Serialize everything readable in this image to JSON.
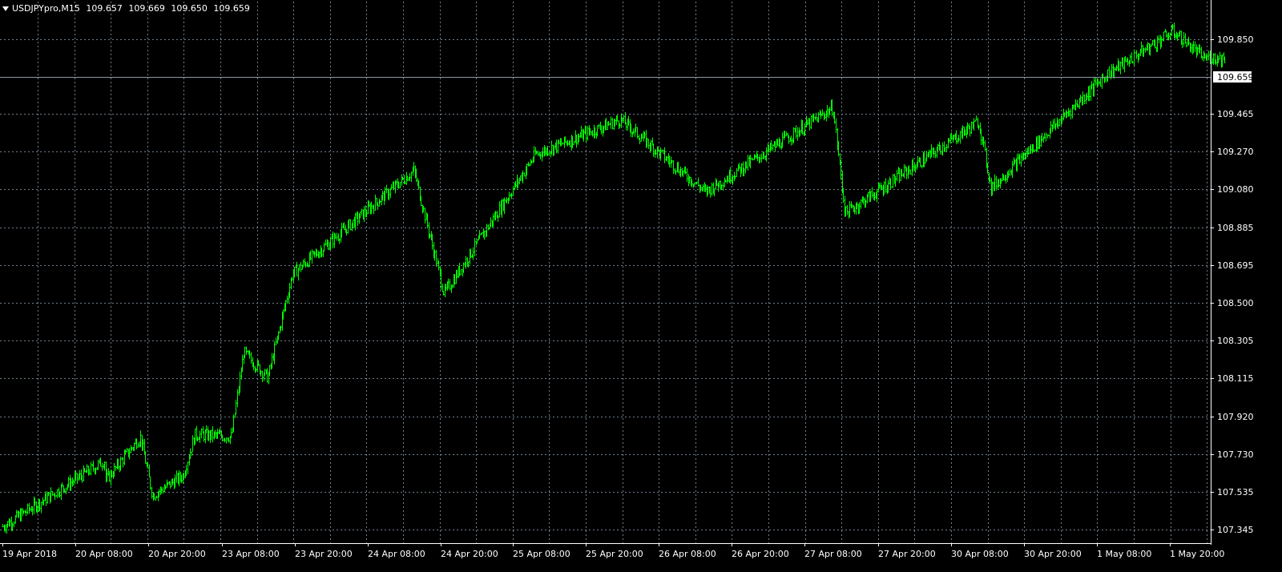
{
  "header": {
    "symbol_tf": "USDJPYpro,M15",
    "open": "109.657",
    "high": "109.669",
    "low": "109.650",
    "close": "109.659"
  },
  "price_axis": {
    "labels": [
      "109.850",
      "109.465",
      "109.270",
      "109.080",
      "108.885",
      "108.695",
      "108.500",
      "108.305",
      "108.115",
      "107.920",
      "107.730",
      "107.535",
      "107.345"
    ],
    "current_price": "109.659"
  },
  "time_axis": {
    "labels": [
      "19 Apr 2018",
      "20 Apr 08:00",
      "20 Apr 20:00",
      "23 Apr 08:00",
      "23 Apr 20:00",
      "24 Apr 08:00",
      "24 Apr 20:00",
      "25 Apr 08:00",
      "25 Apr 20:00",
      "26 Apr 08:00",
      "26 Apr 20:00",
      "27 Apr 08:00",
      "27 Apr 20:00",
      "30 Apr 08:00",
      "30 Apr 20:00",
      "1 May 08:00",
      "1 May 20:00"
    ]
  },
  "colors": {
    "background": "#000000",
    "bars": "#00ff00",
    "grid": "#6f7f8f",
    "axis_text": "#ffffff",
    "price_line": "#8c98a6"
  },
  "chart_data": {
    "type": "line",
    "symbol": "USDJPYpro",
    "timeframe": "M15",
    "style": "bars",
    "x": [
      "19 Apr 2018",
      "20 Apr 08:00",
      "20 Apr 20:00",
      "23 Apr 08:00",
      "23 Apr 20:00",
      "24 Apr 08:00",
      "24 Apr 20:00",
      "25 Apr 08:00",
      "25 Apr 20:00",
      "26 Apr 08:00",
      "26 Apr 20:00",
      "27 Apr 08:00",
      "27 Apr 20:00",
      "30 Apr 08:00",
      "30 Apr 20:00",
      "1 May 08:00",
      "1 May 20:00"
    ],
    "close_at_label": [
      107.38,
      107.6,
      107.6,
      108.2,
      108.72,
      108.92,
      108.88,
      109.24,
      109.34,
      109.26,
      109.29,
      109.33,
      109.07,
      109.32,
      109.27,
      109.66,
      109.8
    ],
    "key_points": [
      {
        "x": "19 Apr 2018",
        "y": 107.36
      },
      {
        "x": "19 Apr 23:00",
        "y": 107.7
      },
      {
        "x": "20 Apr 05:00",
        "y": 107.5
      },
      {
        "x": "20 Apr 13:00",
        "y": 107.82
      },
      {
        "x": "20 Apr 15:00",
        "y": 107.52
      },
      {
        "x": "20 Apr 20:00",
        "y": 107.62
      },
      {
        "x": "20 Apr 22:00",
        "y": 107.83
      },
      {
        "x": "23 Apr 04:00",
        "y": 107.82
      },
      {
        "x": "23 Apr 06:00",
        "y": 108.25
      },
      {
        "x": "23 Apr 10:00",
        "y": 108.12
      },
      {
        "x": "23 Apr 14:00",
        "y": 108.65
      },
      {
        "x": "24 Apr 10:00",
        "y": 109.18
      },
      {
        "x": "24 Apr 15:00",
        "y": 108.55
      },
      {
        "x": "25 Apr 06:00",
        "y": 109.26
      },
      {
        "x": "25 Apr 20:00",
        "y": 109.44
      },
      {
        "x": "26 Apr 10:00",
        "y": 109.07
      },
      {
        "x": "27 Apr 07:00",
        "y": 109.5
      },
      {
        "x": "27 Apr 09:00",
        "y": 108.96
      },
      {
        "x": "30 Apr 07:00",
        "y": 109.43
      },
      {
        "x": "30 Apr 09:00",
        "y": 109.09
      },
      {
        "x": "1 May 04:00",
        "y": 109.67
      },
      {
        "x": "1 May 15:00",
        "y": 109.89
      },
      {
        "x": "1 May 23:30",
        "y": 109.66
      }
    ],
    "ylim": [
      107.33,
      109.97
    ],
    "current_price": 109.659,
    "grid": true
  }
}
